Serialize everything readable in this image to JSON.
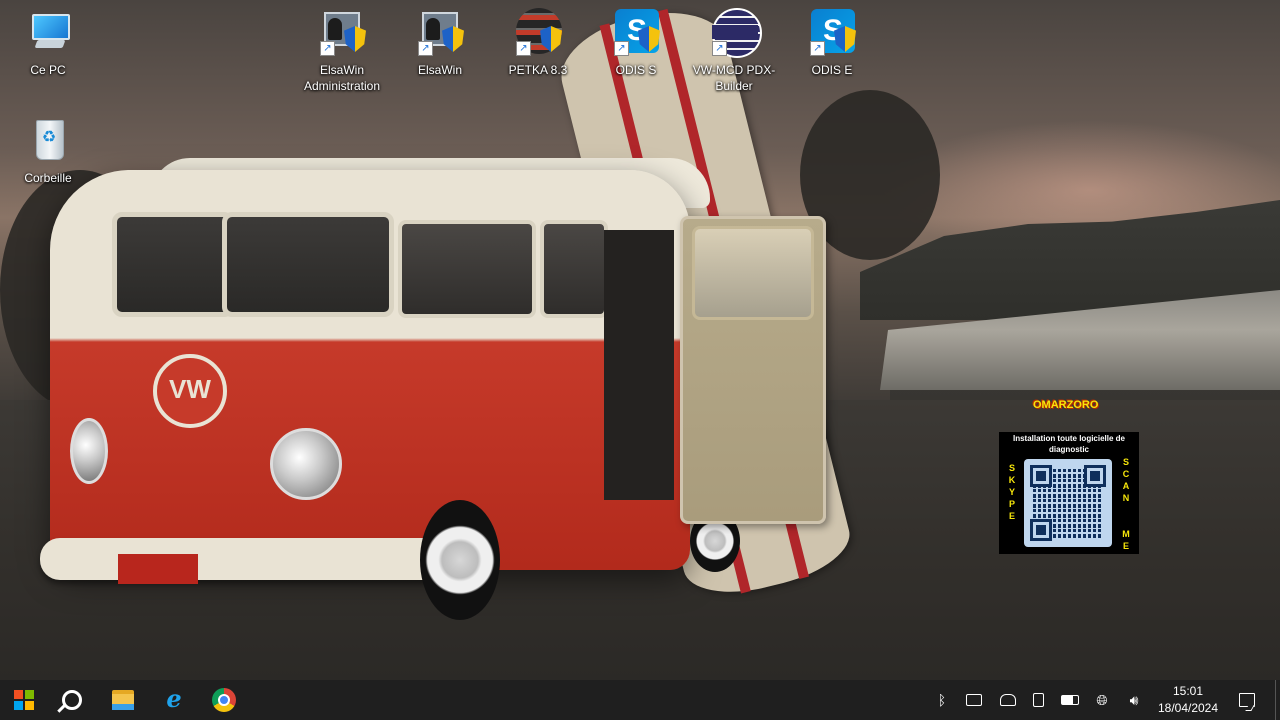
{
  "desktop_icons": [
    {
      "label": "Ce PC",
      "icon": "this-pc-icon"
    },
    {
      "label": "Corbeille",
      "icon": "recycle-bin-icon"
    },
    {
      "label": "ElsaWin Administration",
      "icon": "elsawin-admin-icon"
    },
    {
      "label": "ElsaWin",
      "icon": "elsawin-icon"
    },
    {
      "label": "PETKA 8.3",
      "icon": "petka-icon"
    },
    {
      "label": "ODIS S",
      "icon": "odis-s-icon"
    },
    {
      "label": "VW-MCD PDX-Builder",
      "icon": "vw-mcd-pdx-builder-icon"
    },
    {
      "label": "ODIS E",
      "icon": "odis-e-icon"
    }
  ],
  "widget": {
    "brand": "OMARZORO",
    "title": "Installation toute logicielle de diagnostic",
    "left_vertical": "SKYPE",
    "right_vertical": "SCAN ME",
    "brand_color": "#f6e60b"
  },
  "taskbar": {
    "start": "windows-start-icon",
    "pinned": [
      "search-icon",
      "file-explorer-icon",
      "internet-explorer-icon",
      "chrome-icon"
    ],
    "tray_icons": [
      "bluetooth-icon",
      "meet-now-icon",
      "network-drive-icon",
      "webcam-icon",
      "battery-icon",
      "globe-icon",
      "volume-icon"
    ],
    "time": "15:01",
    "date": "18/04/2024",
    "notifications": "action-center-icon",
    "start_colors": [
      "#f25022",
      "#7fba00",
      "#00a4ef",
      "#ffb900"
    ]
  }
}
